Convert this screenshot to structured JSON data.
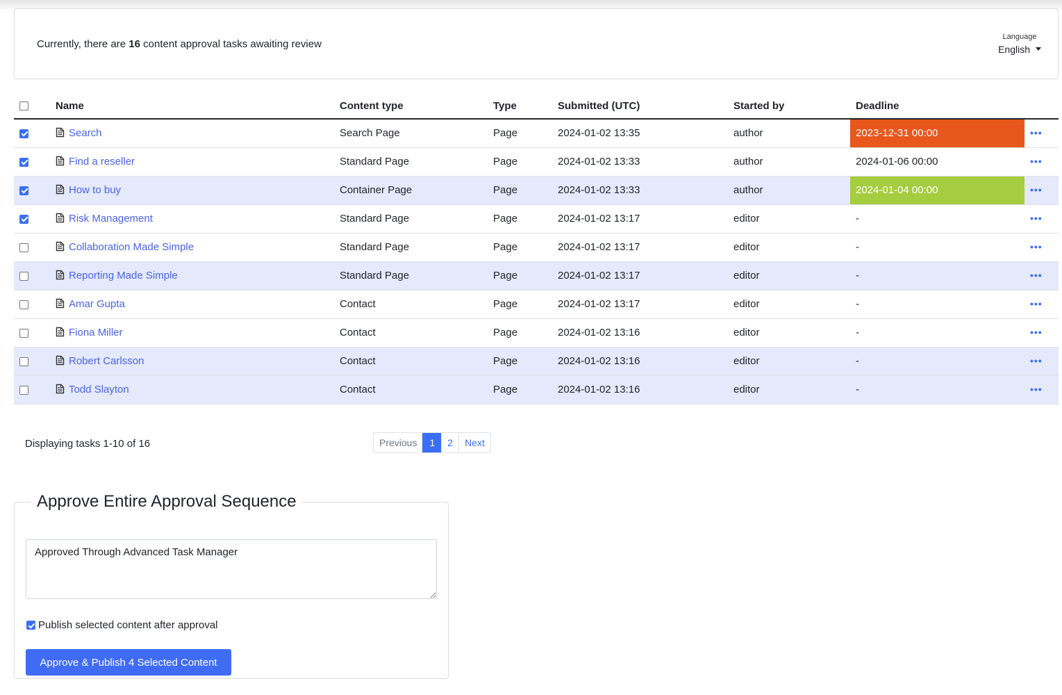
{
  "header": {
    "summary_prefix": "Currently, there are ",
    "summary_count": "16",
    "summary_suffix": " content approval tasks awaiting review",
    "language_label": "Language",
    "language_value": "English"
  },
  "table": {
    "columns": [
      "Name",
      "Content type",
      "Type",
      "Submitted (UTC)",
      "Started by",
      "Deadline"
    ],
    "select_all_checked": false,
    "rows": [
      {
        "checked": true,
        "name": "Search",
        "content_type": "Search Page",
        "type": "Page",
        "submitted": "2024-01-02 13:35",
        "started_by": "author",
        "deadline": "2023-12-31 00:00",
        "deadline_status": "overdue",
        "highlight": false
      },
      {
        "checked": true,
        "name": "Find a reseller",
        "content_type": "Standard Page",
        "type": "Page",
        "submitted": "2024-01-02 13:33",
        "started_by": "author",
        "deadline": "2024-01-06 00:00",
        "deadline_status": "normal",
        "highlight": false
      },
      {
        "checked": true,
        "name": "How to buy",
        "content_type": "Container Page",
        "type": "Page",
        "submitted": "2024-01-02 13:33",
        "started_by": "author",
        "deadline": "2024-01-04 00:00",
        "deadline_status": "upcoming",
        "highlight": true
      },
      {
        "checked": true,
        "name": "Risk Management",
        "content_type": "Standard Page",
        "type": "Page",
        "submitted": "2024-01-02 13:17",
        "started_by": "editor",
        "deadline": "-",
        "deadline_status": "none",
        "highlight": false
      },
      {
        "checked": false,
        "name": "Collaboration Made Simple",
        "content_type": "Standard Page",
        "type": "Page",
        "submitted": "2024-01-02 13:17",
        "started_by": "editor",
        "deadline": "-",
        "deadline_status": "none",
        "highlight": false
      },
      {
        "checked": false,
        "name": "Reporting Made Simple",
        "content_type": "Standard Page",
        "type": "Page",
        "submitted": "2024-01-02 13:17",
        "started_by": "editor",
        "deadline": "-",
        "deadline_status": "none",
        "highlight": true
      },
      {
        "checked": false,
        "name": "Amar Gupta",
        "content_type": "Contact",
        "type": "Page",
        "submitted": "2024-01-02 13:17",
        "started_by": "editor",
        "deadline": "-",
        "deadline_status": "none",
        "highlight": false
      },
      {
        "checked": false,
        "name": "Fiona Miller",
        "content_type": "Contact",
        "type": "Page",
        "submitted": "2024-01-02 13:16",
        "started_by": "editor",
        "deadline": "-",
        "deadline_status": "none",
        "highlight": false
      },
      {
        "checked": false,
        "name": "Robert Carlsson",
        "content_type": "Contact",
        "type": "Page",
        "submitted": "2024-01-02 13:16",
        "started_by": "editor",
        "deadline": "-",
        "deadline_status": "none",
        "highlight": true
      },
      {
        "checked": false,
        "name": "Todd Slayton",
        "content_type": "Contact",
        "type": "Page",
        "submitted": "2024-01-02 13:16",
        "started_by": "editor",
        "deadline": "-",
        "deadline_status": "none",
        "highlight": true
      }
    ],
    "row_action_icon": "more-horizontal-icon",
    "row_name_icon": "document-icon"
  },
  "pagination": {
    "displaying": "Displaying tasks 1-10 of 16",
    "previous": "Previous",
    "pages": [
      "1",
      "2"
    ],
    "current_page": "1",
    "next": "Next"
  },
  "approve": {
    "legend": "Approve Entire Approval Sequence",
    "comment": "Approved Through Advanced Task Manager",
    "publish_checked": true,
    "publish_label": "Publish selected content after approval",
    "button_label": "Approve & Publish 4 Selected Content"
  },
  "colors": {
    "accent": "#3b6ef6",
    "link": "#4a63e6",
    "overdue": "#e8571b",
    "upcoming": "#a6cc3f",
    "row_highlight": "#e4e9fb"
  }
}
